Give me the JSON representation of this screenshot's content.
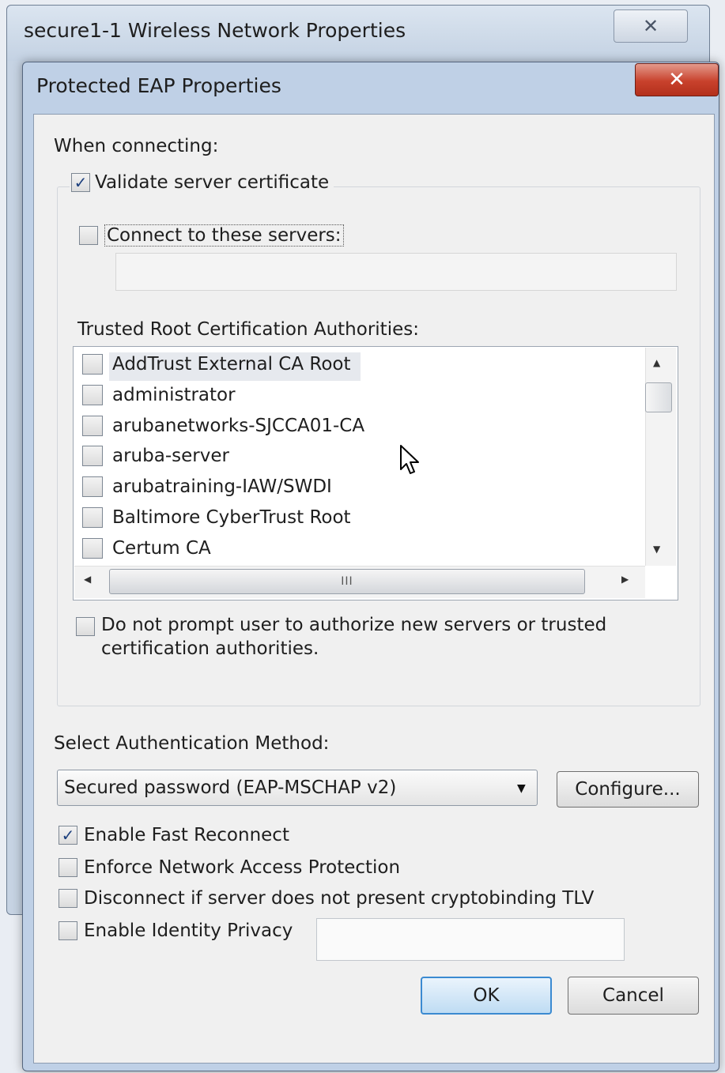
{
  "bg_window": {
    "title": "secure1-1 Wireless Network Properties",
    "close_glyph": "✕"
  },
  "window": {
    "title": "Protected EAP Properties",
    "close_glyph": "✕"
  },
  "when_connecting_label": "When connecting:",
  "validate": {
    "checked": true,
    "label": "Validate server certificate"
  },
  "connect_servers": {
    "checked": false,
    "label": "Connect to these servers:",
    "value": ""
  },
  "trusted_label": "Trusted Root Certification Authorities:",
  "ca_list": [
    {
      "label": "AddTrust External CA Root",
      "checked": false,
      "selected": true
    },
    {
      "label": "administrator",
      "checked": false
    },
    {
      "label": "arubanetworks-SJCCA01-CA",
      "checked": false
    },
    {
      "label": "aruba-server",
      "checked": false
    },
    {
      "label": "arubatraining-IAW/SWDI",
      "checked": false
    },
    {
      "label": "Baltimore CyberTrust Root",
      "checked": false
    },
    {
      "label": "Certum CA",
      "checked": false
    }
  ],
  "scroll": {
    "up": "▲",
    "down": "▼",
    "left": "◀",
    "right": "▶",
    "grip": "III"
  },
  "no_prompt": {
    "checked": false,
    "line1": "Do not prompt user to authorize new servers or trusted",
    "line2": "certification authorities."
  },
  "auth_method_label": "Select Authentication Method:",
  "auth_method_value": "Secured password (EAP-MSCHAP v2)",
  "configure_label": "Configure...",
  "options": [
    {
      "label": "Enable Fast Reconnect",
      "checked": true
    },
    {
      "label": "Enforce Network Access Protection",
      "checked": false
    },
    {
      "label": "Disconnect if server does not present cryptobinding TLV",
      "checked": false
    },
    {
      "label": "Enable Identity Privacy",
      "checked": false
    }
  ],
  "identity_value": "",
  "ok_label": "OK",
  "cancel_label": "Cancel",
  "check_glyph": "✓",
  "colors": {
    "accent": "#3b8ad1",
    "close_red": "#c8412c"
  }
}
